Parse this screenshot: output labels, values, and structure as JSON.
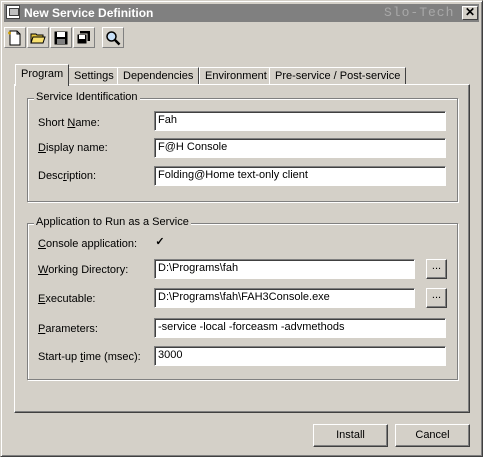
{
  "window": {
    "title": "New Service Definition",
    "watermark": "Slo-Tech",
    "close_glyph": "✕"
  },
  "toolbar": {
    "buttons": [
      {
        "name": "new-icon"
      },
      {
        "name": "open-folder-icon"
      },
      {
        "name": "save-disk-icon"
      },
      {
        "name": "save-all-icon"
      },
      {
        "name": "search-icon"
      }
    ]
  },
  "tabs": [
    {
      "label": "Program",
      "active": true
    },
    {
      "label": "Settings"
    },
    {
      "label": "Dependencies"
    },
    {
      "label": "Environment"
    },
    {
      "label": "Pre-service / Post-service"
    }
  ],
  "service_identification": {
    "title": "Service Identification",
    "short_name": {
      "label_pre": "Short ",
      "label_u": "N",
      "label_post": "ame:",
      "value": "Fah"
    },
    "display_name": {
      "label_pre": "",
      "label_u": "D",
      "label_post": "isplay name:",
      "value": "F@H Console"
    },
    "description": {
      "label_pre": "Desc",
      "label_u": "r",
      "label_post": "iption:",
      "value": "Folding@Home text-only client"
    }
  },
  "application": {
    "title": "Application to Run as a Service",
    "console": {
      "label_pre": "",
      "label_u": "C",
      "label_post": "onsole application:",
      "checked": "✓"
    },
    "working_dir": {
      "label_pre": "",
      "label_u": "W",
      "label_post": "orking Directory:",
      "value": "D:\\Programs\\fah",
      "browse": "..."
    },
    "executable": {
      "label_pre": "",
      "label_u": "E",
      "label_post": "xecutable:",
      "value": "D:\\Programs\\fah\\FAH3Console.exe",
      "browse": "..."
    },
    "parameters": {
      "label_pre": "",
      "label_u": "P",
      "label_post": "arameters:",
      "value": "-service -local -forceasm -advmethods"
    },
    "startup": {
      "label_pre": "Start-up ",
      "label_u": "t",
      "label_post": "ime (msec):",
      "value": "3000"
    }
  },
  "footer": {
    "install": "Install",
    "cancel": "Cancel"
  }
}
